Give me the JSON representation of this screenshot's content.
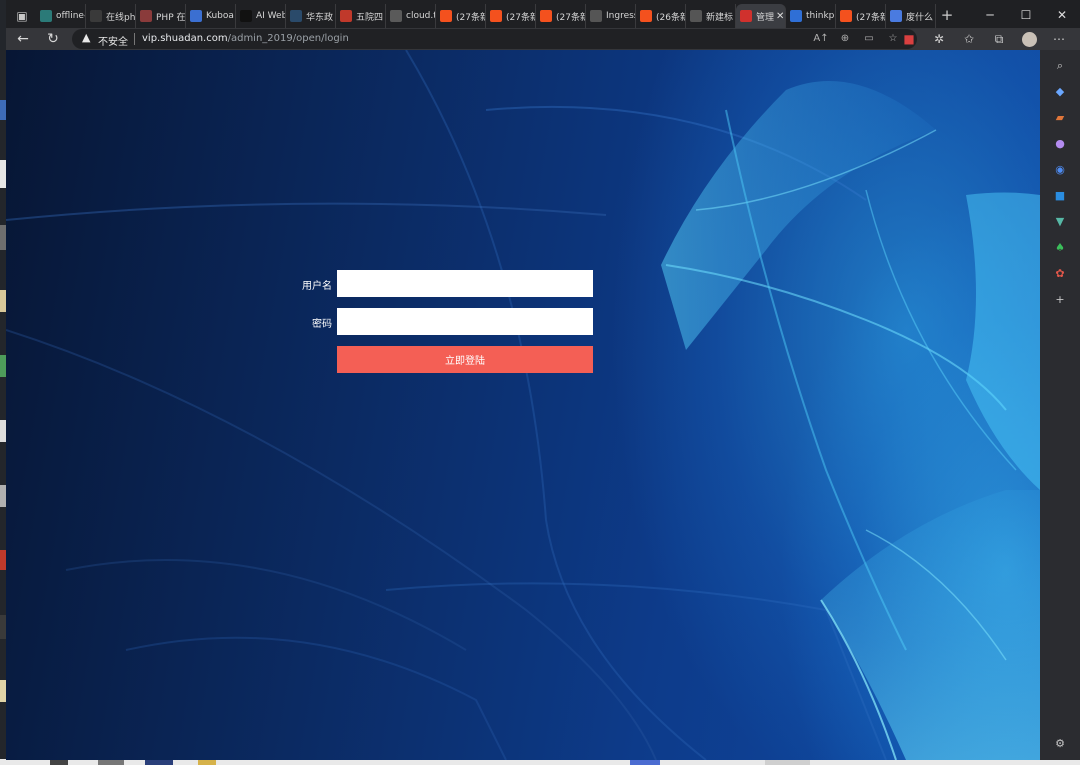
{
  "browser": {
    "tabs": [
      {
        "title": "offline-",
        "favicon": "doc-icon",
        "color": "#2b7a78"
      },
      {
        "title": "在线ph",
        "favicon": "search-icon",
        "color": "#3a3a3a"
      },
      {
        "title": "PHP 在",
        "favicon": "php-icon",
        "color": "#8a3b3b"
      },
      {
        "title": "Kuboa",
        "favicon": "k-icon",
        "color": "#3b6fd1"
      },
      {
        "title": "AI Web",
        "favicon": "ai-icon",
        "color": "#111111"
      },
      {
        "title": "华东政",
        "favicon": "school-icon",
        "color": "#2a4a6a"
      },
      {
        "title": "五院四",
        "favicon": "eye-icon",
        "color": "#c0392b"
      },
      {
        "title": "cloud.t",
        "favicon": "page-icon",
        "color": "#5a5a5a"
      },
      {
        "title": "(27条新",
        "favicon": "csdn-icon",
        "color": "#f4511e"
      },
      {
        "title": "(27条新",
        "favicon": "csdn-icon",
        "color": "#f4511e"
      },
      {
        "title": "(27条新",
        "favicon": "csdn-icon",
        "color": "#f4511e"
      },
      {
        "title": "Ingress",
        "favicon": "ingress-icon",
        "color": "#555555"
      },
      {
        "title": "(26条新",
        "favicon": "csdn-icon",
        "color": "#f4511e"
      },
      {
        "title": "新建标",
        "favicon": "newtab-icon",
        "color": "#555555"
      },
      {
        "title": "管理",
        "favicon": "admin-icon",
        "color": "#d0312d",
        "active": true
      },
      {
        "title": "thinkp",
        "favicon": "search-icon",
        "color": "#2f6fd6"
      },
      {
        "title": "(27条新",
        "favicon": "csdn-icon",
        "color": "#f4511e"
      },
      {
        "title": "废什么",
        "favicon": "diamond-icon",
        "color": "#4a7be0"
      }
    ],
    "insecure_label": "不安全",
    "url_host": "vip.shuadan.com",
    "url_path": "/admin_2019/open/login"
  },
  "login": {
    "username_label": "用户名",
    "password_label": "密码",
    "username_value": "",
    "password_value": "",
    "submit_label": "立即登陆",
    "button_color": "#f45f55"
  }
}
